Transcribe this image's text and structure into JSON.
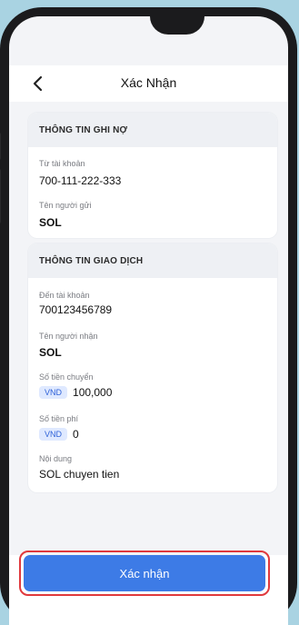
{
  "header": {
    "title": "Xác Nhận"
  },
  "debit_section": {
    "heading": "THÔNG TIN GHI NỢ",
    "from_account_label": "Từ tài khoản",
    "from_account_value": "700-111-222-333",
    "sender_label": "Tên người gửi",
    "sender_value": "SOL"
  },
  "transaction_section": {
    "heading": "THÔNG TIN GIAO DỊCH",
    "to_account_label": "Đến tài khoản",
    "to_account_value": "700123456789",
    "receiver_label": "Tên người nhận",
    "receiver_value": "SOL",
    "amount_label": "Số tiền chuyển",
    "amount_currency": "VND",
    "amount_value": "100,000",
    "fee_label": "Số tiền phí",
    "fee_currency": "VND",
    "fee_value": "0",
    "content_label": "Nội dung",
    "content_value": "SOL chuyen tien"
  },
  "footer": {
    "confirm_label": "Xác nhận"
  },
  "colors": {
    "accent": "#3d7be6",
    "highlight_border": "#e0393d",
    "badge_bg": "#dfe9ff"
  }
}
